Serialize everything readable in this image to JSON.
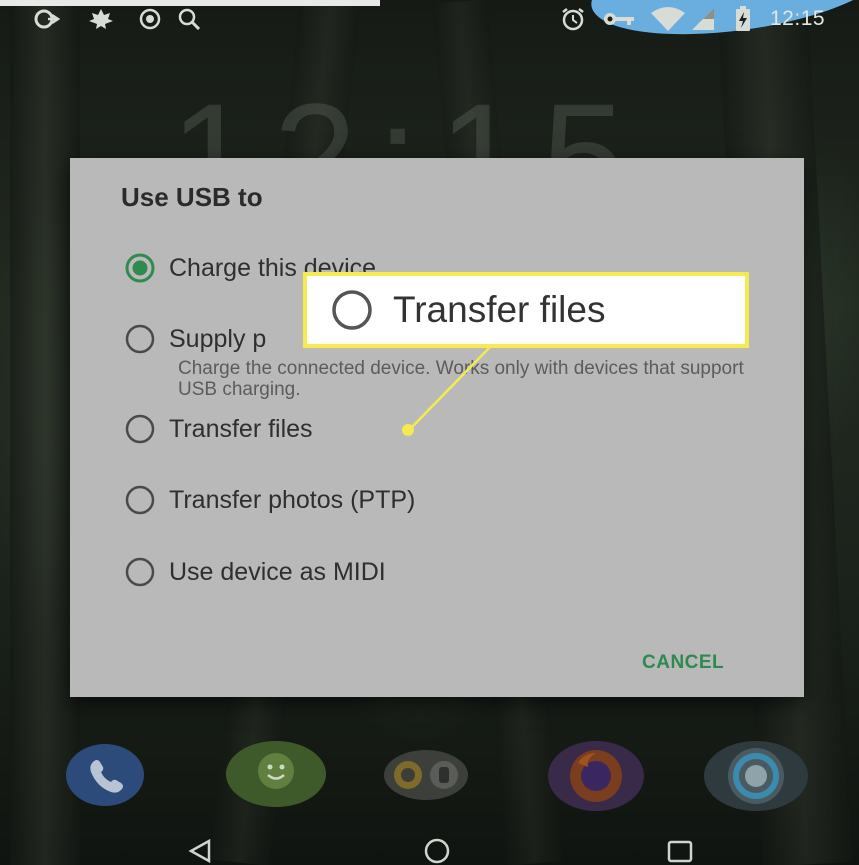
{
  "status_bar": {
    "time": "12:15",
    "left_icons": [
      "link-icon",
      "leaf-icon",
      "record-icon",
      "search-icon"
    ],
    "right_icons": [
      "alarm-icon",
      "key-icon",
      "wifi-icon",
      "signal-icon",
      "battery-charging-icon"
    ]
  },
  "lockscreen": {
    "clock": "12:15"
  },
  "dialog": {
    "title": "Use USB to",
    "options": [
      {
        "label": "Charge this device",
        "selected": true
      },
      {
        "label": "Supply p",
        "selected": false,
        "description": "Charge the connected device. Works only with devices that support USB charging."
      },
      {
        "label": "Transfer files",
        "selected": false
      },
      {
        "label": "Transfer photos (PTP)",
        "selected": false
      },
      {
        "label": "Use device as MIDI",
        "selected": false
      }
    ],
    "cancel_label": "CANCEL"
  },
  "callout": {
    "label": "Transfer files",
    "color": "#f6ea52"
  },
  "dock": {
    "apps": [
      "phone-icon",
      "messenger-icon",
      "camera-icon",
      "firefox-icon",
      "chrome-icon"
    ]
  },
  "nav_bar": {
    "buttons": [
      "back-icon",
      "home-icon",
      "recents-icon"
    ]
  },
  "colors": {
    "accent_green": "#2f8a50",
    "dialog_bg": "#b9b9b9",
    "callout_border": "#f6ea52"
  }
}
